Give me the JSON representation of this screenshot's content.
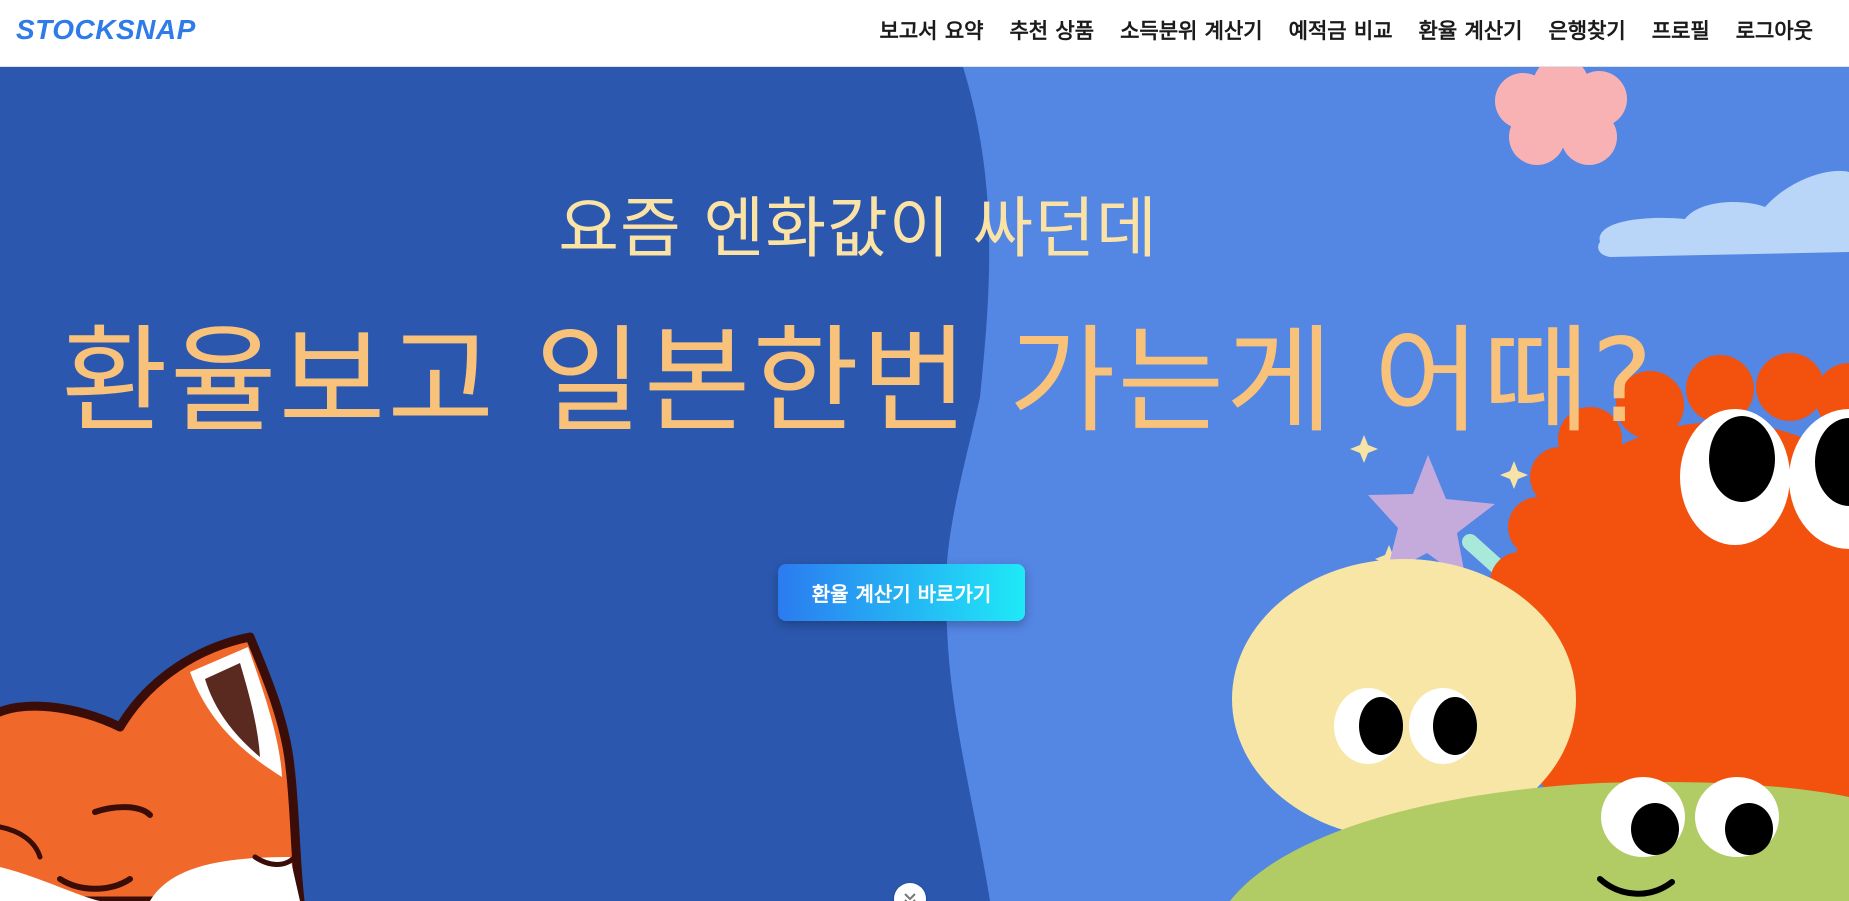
{
  "brand": {
    "name": "STOCKSNAP"
  },
  "nav": {
    "items": [
      {
        "label": "보고서 요약"
      },
      {
        "label": "추천 상품"
      },
      {
        "label": "소득분위 계산기"
      },
      {
        "label": "예적금 비교"
      },
      {
        "label": "환율 계산기"
      },
      {
        "label": "은행찾기"
      },
      {
        "label": "프로필"
      },
      {
        "label": "로그아웃"
      }
    ]
  },
  "hero": {
    "subtitle": "요즘 엔화값이 싸던데",
    "title": "환율보고 일본한번 가는게 어때?",
    "cta_label": "환율 계산기 바로가기"
  },
  "icons": {
    "scroll": "chevron-down-icon",
    "illustration_left": "fox-illustration",
    "illustration_right": "cute-monsters-illustration"
  },
  "colors": {
    "brand": "#2f7be8",
    "hero_left_bg": "#2b58ae",
    "hero_right_bg": "#5486e4",
    "subtitle_text": "#fbe3a6",
    "title_text": "#f8c27b",
    "cta_gradient_start": "#2b7bf0",
    "cta_gradient_end": "#1fe9f7"
  }
}
